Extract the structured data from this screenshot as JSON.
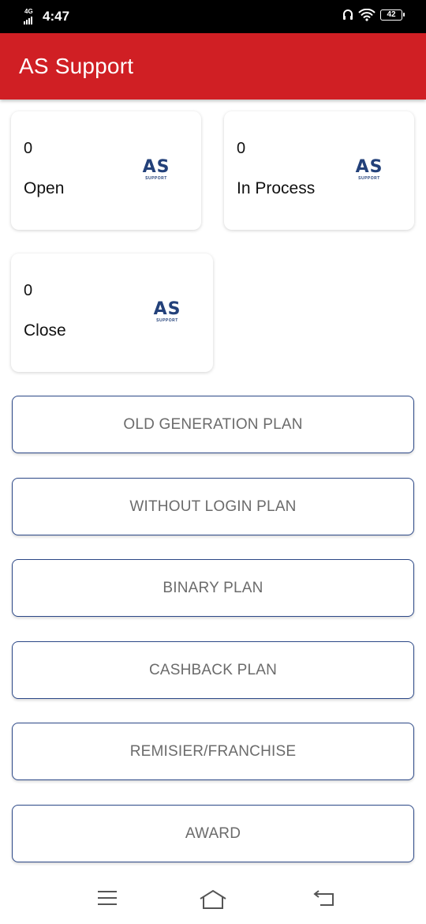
{
  "status_bar": {
    "network": "4G",
    "time": "4:47",
    "battery": "42"
  },
  "app_bar": {
    "title": "AS Support"
  },
  "cards": [
    {
      "count": "0",
      "label": "Open",
      "logo_text": "AS",
      "logo_sub": "SUPPORT"
    },
    {
      "count": "0",
      "label": "In Process",
      "logo_text": "AS",
      "logo_sub": "SUPPORT"
    },
    {
      "count": "0",
      "label": "Close",
      "logo_text": "AS",
      "logo_sub": "SUPPORT"
    }
  ],
  "plans": [
    {
      "label": "OLD GENERATION PLAN"
    },
    {
      "label": "WITHOUT LOGIN PLAN"
    },
    {
      "label": "BINARY PLAN"
    },
    {
      "label": "CASHBACK PLAN"
    },
    {
      "label": "REMISIER/FRANCHISE"
    },
    {
      "label": "AWARD"
    }
  ],
  "nav": {
    "items": [
      "menu-icon",
      "home-icon",
      "back-icon"
    ]
  },
  "colors": {
    "app_bar": "#d01f24",
    "status_bar": "#000000",
    "button_border": "#2c4887",
    "logo": "#23417a",
    "button_text": "#6b6b6b"
  }
}
